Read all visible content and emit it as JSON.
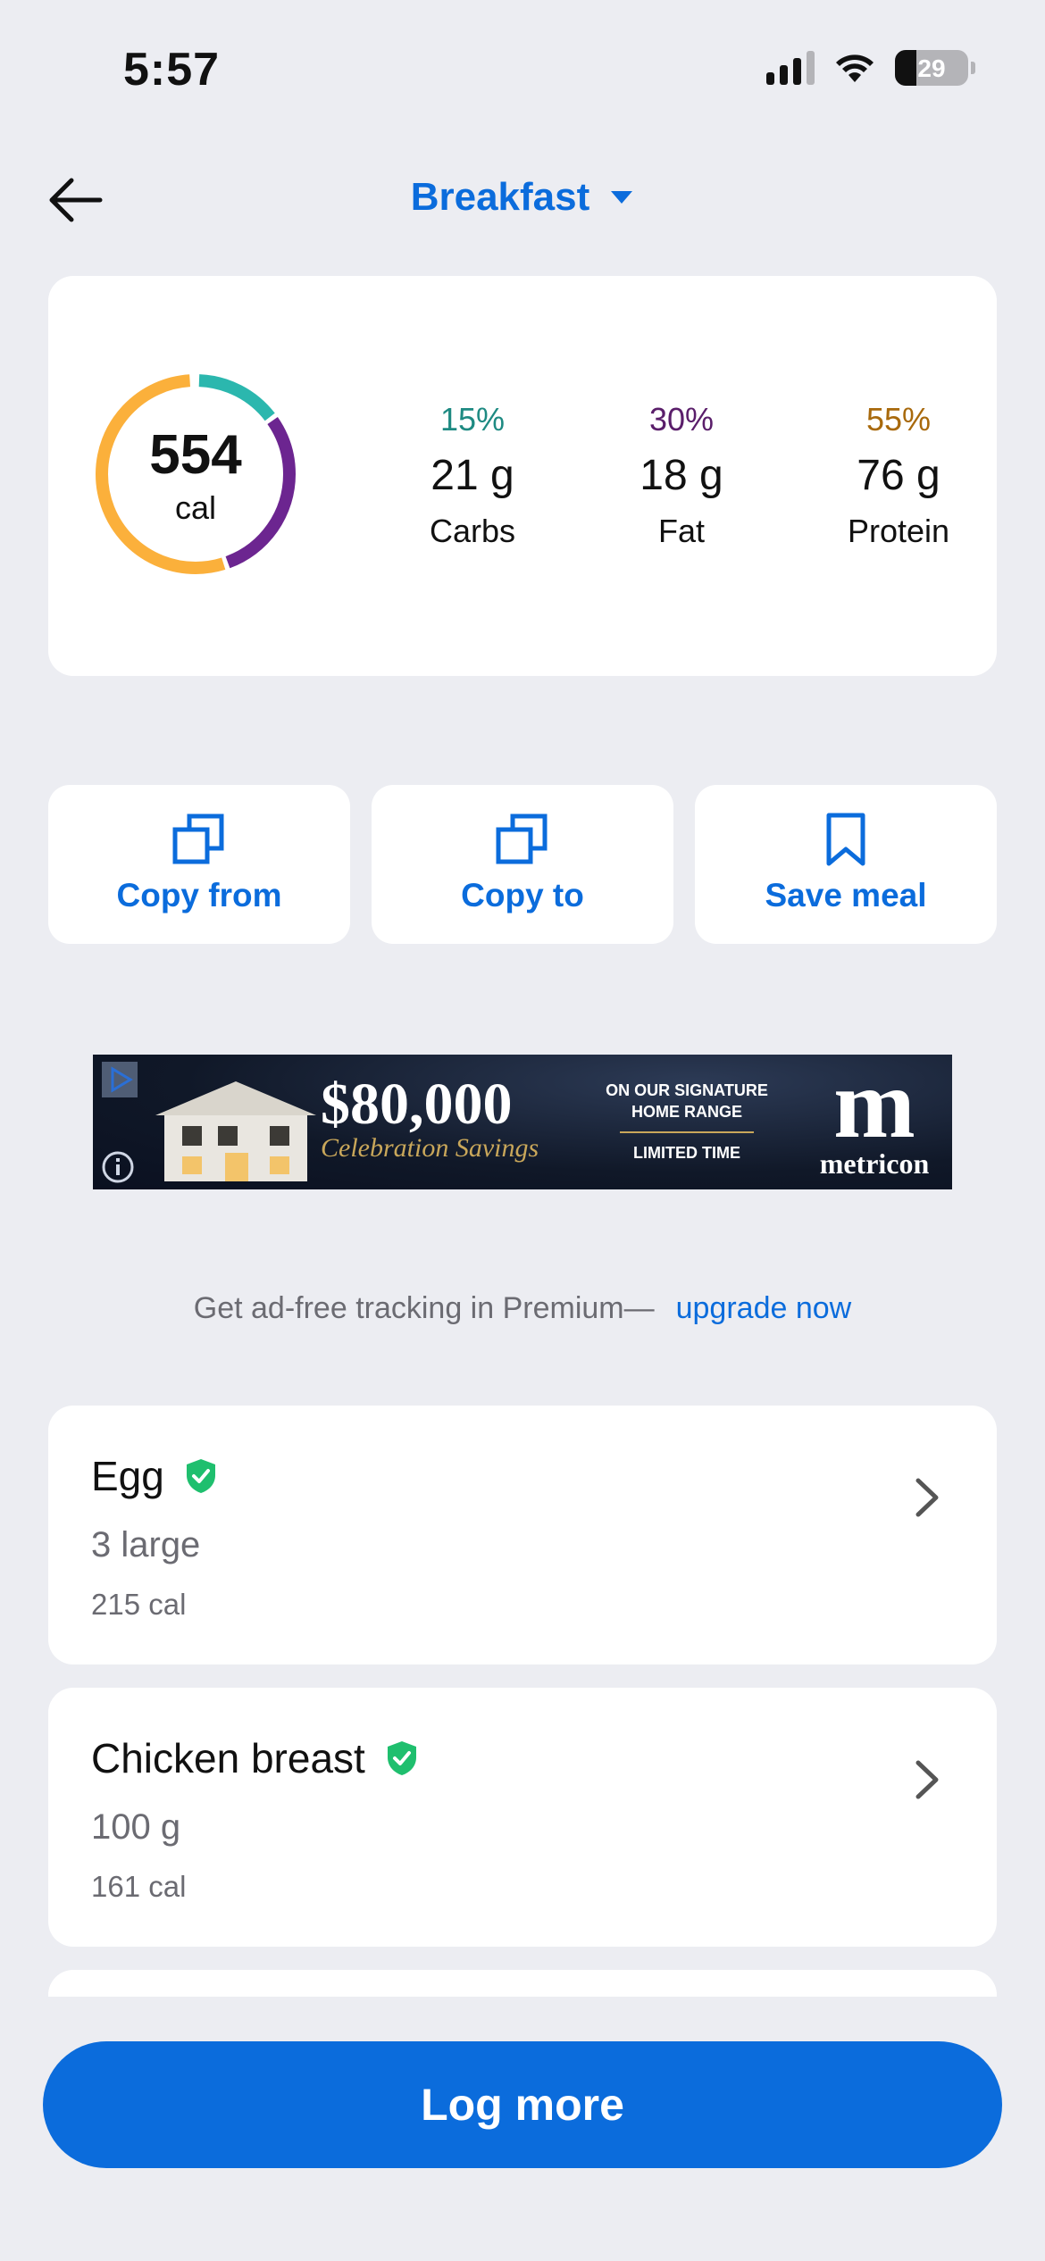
{
  "status_bar": {
    "time": "5:57",
    "battery": "29"
  },
  "header": {
    "meal": "Breakfast"
  },
  "summary": {
    "calories": "554",
    "calories_unit": "cal",
    "macros": [
      {
        "percent": "15%",
        "grams": "21 g",
        "label": "Carbs",
        "color": "#1e8a82"
      },
      {
        "percent": "30%",
        "grams": "18 g",
        "label": "Fat",
        "color": "#5a1e6a"
      },
      {
        "percent": "55%",
        "grams": "76 g",
        "label": "Protein",
        "color": "#a8690c"
      }
    ],
    "ring_colors": {
      "carbs": "#2bb7ae",
      "fat": "#6c2590",
      "protein": "#fbb03b"
    }
  },
  "actions": {
    "copy_from": "Copy from",
    "copy_to": "Copy to",
    "save_meal": "Save meal"
  },
  "ad": {
    "price": "$80,000",
    "subtitle": "Celebration Savings",
    "signature": "ON OUR SIGNATURE HOME RANGE",
    "limited": "LIMITED TIME",
    "brand_mark": "m",
    "brand": "metricon"
  },
  "upsell": {
    "text": "Get ad-free tracking in Premium—",
    "link": "upgrade now"
  },
  "foods": [
    {
      "name": "Egg",
      "serving": "3 large",
      "calories": "215 cal"
    },
    {
      "name": "Chicken breast",
      "serving": "100 g",
      "calories": "161 cal"
    }
  ],
  "log_more": "Log more",
  "colors": {
    "accent": "#0b6cdc",
    "verified": "#1fbf6e",
    "background": "#ecedf2"
  }
}
